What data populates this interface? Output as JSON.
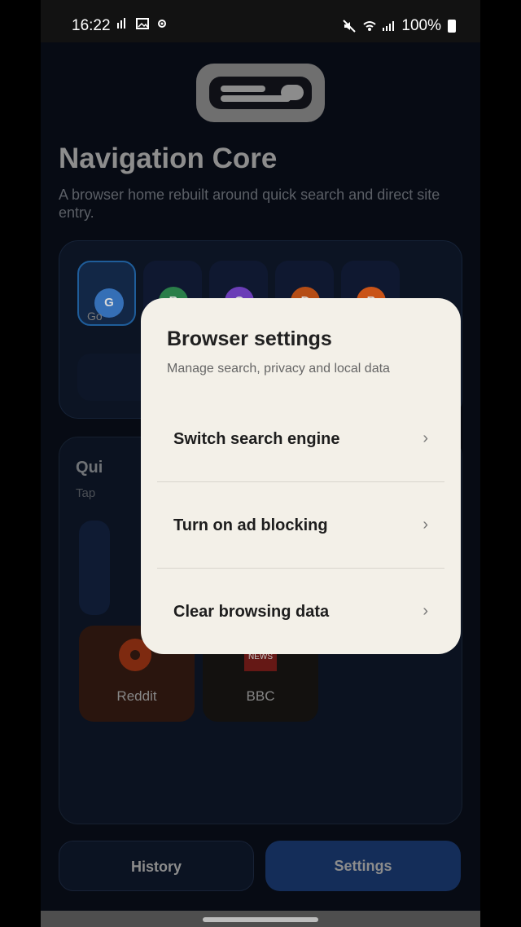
{
  "status": {
    "time": "16:22",
    "battery": "100%"
  },
  "app": {
    "title": "Navigation Core",
    "subtitle": "A browser home rebuilt around quick search and direct site entry."
  },
  "engines": [
    {
      "letter": "G",
      "label": "Go",
      "color": "#356fb6"
    },
    {
      "letter": "B",
      "label": "",
      "color": "#2a7e49"
    },
    {
      "letter": "Q",
      "label": "",
      "color": "#6b3db7"
    },
    {
      "letter": "D",
      "label": "",
      "color": "#b54d15"
    },
    {
      "letter": "B",
      "label": "",
      "color": "#c95317"
    }
  ],
  "quick": {
    "title": "Qui",
    "subtitle": "Tap"
  },
  "tiles": [
    {
      "label": "Reddit"
    },
    {
      "label": "BBC",
      "icon_text": "NEWS"
    }
  ],
  "bottom": {
    "history": "History",
    "settings": "Settings"
  },
  "dialog": {
    "title": "Browser settings",
    "subtitle": "Manage search, privacy and local data",
    "items": [
      {
        "label": "Switch search engine",
        "chevron": "›"
      },
      {
        "label": "Turn on ad blocking",
        "chevron": "›"
      },
      {
        "label": "Clear browsing data",
        "chevron": "›"
      }
    ]
  }
}
